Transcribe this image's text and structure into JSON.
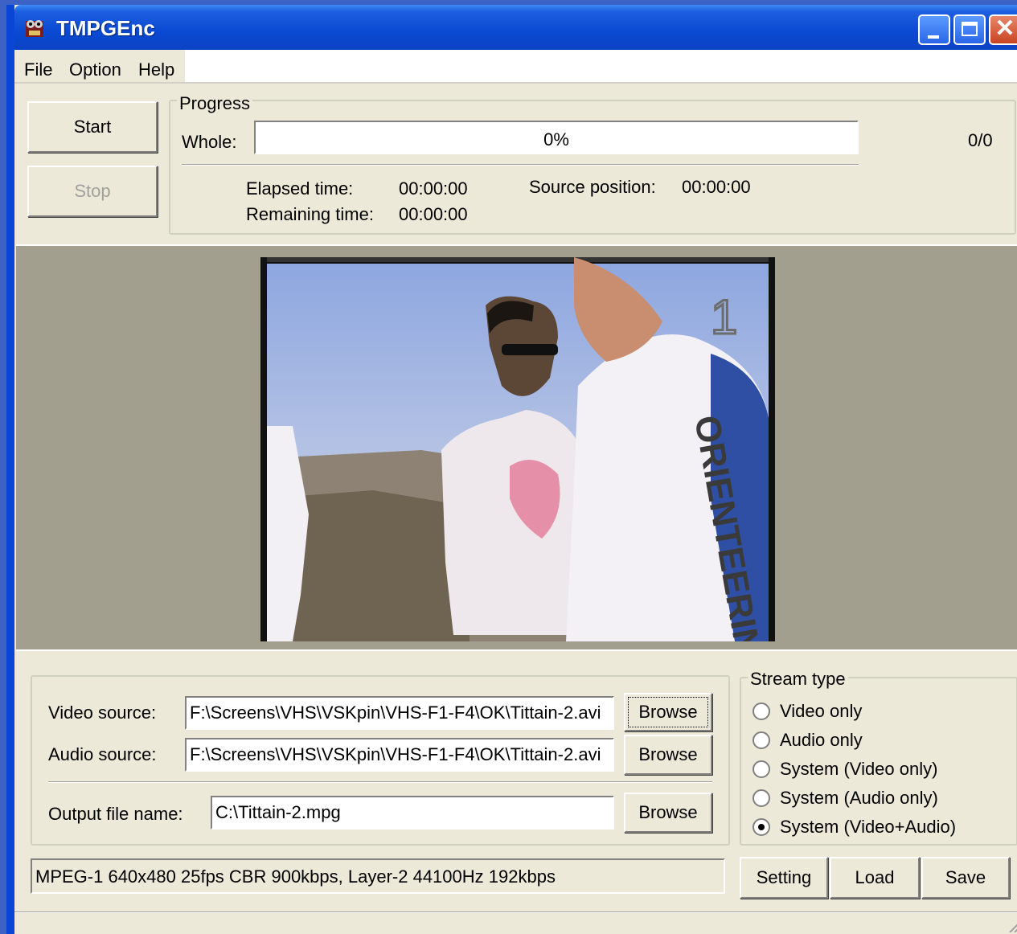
{
  "window": {
    "title": "TMPGEnc"
  },
  "menu": {
    "file": "File",
    "option": "Option",
    "help": "Help"
  },
  "controls": {
    "start": "Start",
    "stop": "Stop"
  },
  "progress": {
    "group_label": "Progress",
    "whole_label": "Whole:",
    "whole_value": "0%",
    "whole_fraction": 0,
    "count": "0/0",
    "elapsed_label": "Elapsed time:",
    "elapsed_value": "00:00:00",
    "remaining_label": "Remaining time:",
    "remaining_value": "00:00:00",
    "source_position_label": "Source position:",
    "source_position_value": "00:00:00"
  },
  "sources": {
    "video_label": "Video source:",
    "video_value": "F:\\Screens\\VHS\\VSKpin\\VHS-F1-F4\\OK\\Tittain-2.avi",
    "audio_label": "Audio source:",
    "audio_value": "F:\\Screens\\VHS\\VSKpin\\VHS-F1-F4\\OK\\Tittain-2.avi",
    "output_label": "Output file name:",
    "output_value": "C:\\Tittain-2.mpg",
    "browse": "Browse"
  },
  "stream_type": {
    "group_label": "Stream type",
    "options": [
      "Video only",
      "Audio only",
      "System (Video only)",
      "System (Audio only)",
      "System (Video+Audio)"
    ],
    "selected_index": 4
  },
  "status": "MPEG-1 640x480 25fps CBR 900kbps,  Layer-2 44100Hz 192kbps",
  "actions": {
    "setting": "Setting",
    "load": "Load",
    "save": "Save"
  },
  "preview": {
    "overlay_digit": "1",
    "shirt_text": "ORIENTEERING"
  },
  "colors": {
    "titlebar": "#0a49d2",
    "face": "#ece9d8",
    "preview_bg": "#a39f8e"
  }
}
